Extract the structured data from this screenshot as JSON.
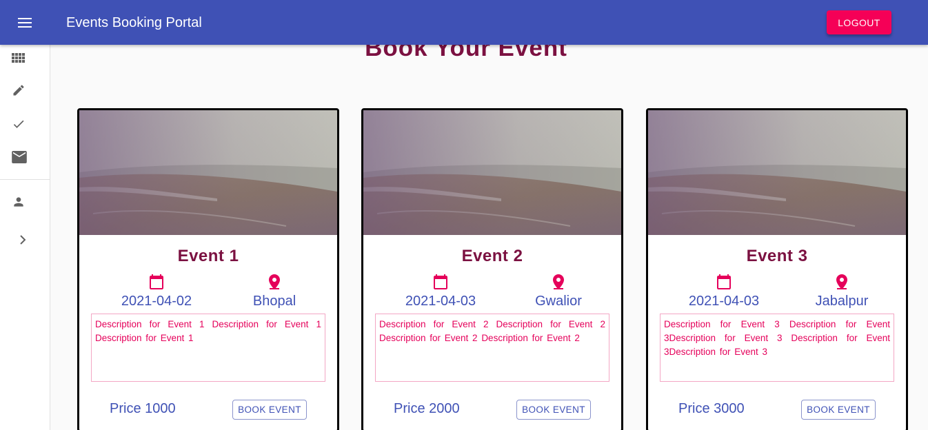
{
  "appbar": {
    "title": "Events Booking Portal",
    "logout_label": "LOGOUT",
    "bg_color": "#3f51b5",
    "logout_color": "#f50057"
  },
  "drawer": {
    "items": [
      {
        "icon": "apps-grid-icon"
      },
      {
        "icon": "edit-pencil-icon"
      },
      {
        "icon": "check-icon"
      },
      {
        "icon": "mail-icon"
      },
      {
        "icon": "person-icon"
      },
      {
        "icon": "chevron-right-icon"
      }
    ]
  },
  "main": {
    "heading": "Book Your Event",
    "events": [
      {
        "title": "Event 1",
        "date": "2021-04-02",
        "location": "Bhopal",
        "description": "Description for Event 1 Description for Event 1 Description for Event 1",
        "price": "Price 1000",
        "book_label": "BOOK EVENT"
      },
      {
        "title": "Event 2",
        "date": "2021-04-03",
        "location": "Gwalior",
        "description": "Description for Event 2 Description for Event 2 Description for Event 2 Description for Event 2",
        "price": "Price 2000",
        "book_label": "BOOK EVENT"
      },
      {
        "title": "Event 3",
        "date": "2021-04-03",
        "location": "Jabalpur",
        "description": "Description for Event 3 Description for Event 3Description for Event 3 Description for Event 3Description for Event 3",
        "price": "Price 3000",
        "book_label": "BOOK EVENT"
      }
    ]
  }
}
